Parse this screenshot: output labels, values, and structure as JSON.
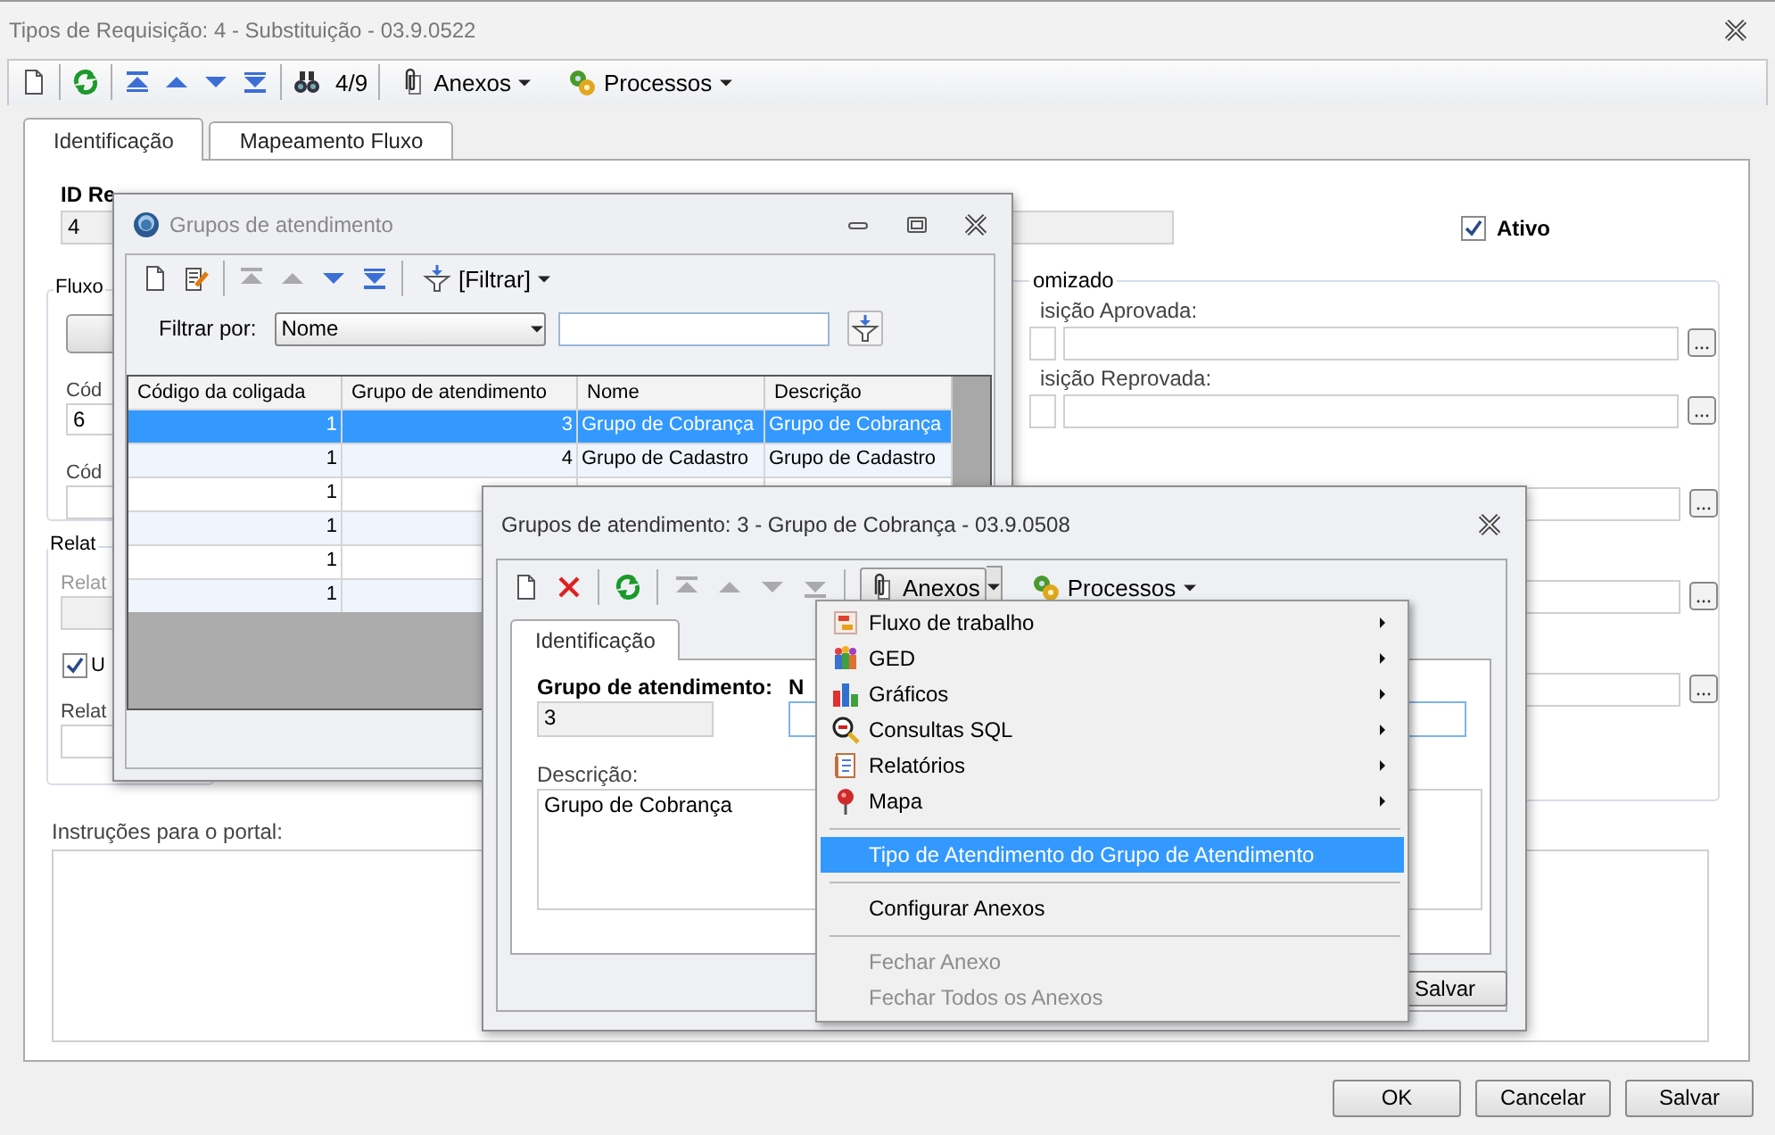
{
  "window": {
    "title": "Tipos de Requisição: 4 - Substituição - 03.9.0522"
  },
  "toolbar": {
    "record_counter": "4/9",
    "anexos": "Anexos",
    "processos": "Processos"
  },
  "tabs": [
    {
      "label": "Identificação",
      "selected": true
    },
    {
      "label": "Mapeamento Fluxo",
      "selected": false
    }
  ],
  "form": {
    "id_label": "ID Re",
    "id_value": "4",
    "ativo": {
      "label": "Ativo",
      "checked": true
    },
    "fluxo_group": {
      "title": "Fluxo",
      "label_1": "Cód",
      "value_1": "6",
      "label_2": "Cód"
    },
    "relat_group": {
      "title": "Relat",
      "label_1": "Relat",
      "check": {
        "label": "U",
        "checked": true
      },
      "label_2": "Relat"
    },
    "custom_group": {
      "title": "omizado",
      "label_approved": "isição Aprovada:",
      "label_rejected": "isição Reprovada:"
    },
    "instructions_label": "Instruções para o portal:"
  },
  "buttons": [
    {
      "label": "OK"
    },
    {
      "label": "Cancelar"
    },
    {
      "label": "Salvar"
    }
  ],
  "grupos_window": {
    "title": "Grupos de atendimento",
    "filter_button": "[Filtrar]",
    "filter_by_label": "Filtrar por:",
    "filter_by_value": "Nome",
    "columns": [
      "Código da coligada",
      "Grupo de atendimento",
      "Nome",
      "Descrição"
    ],
    "rows": [
      {
        "coligada": "1",
        "grupo": "3",
        "nome": "Grupo de Cobrança",
        "descricao": "Grupo de Cobrança",
        "selected": true
      },
      {
        "coligada": "1",
        "grupo": "4",
        "nome": "Grupo de Cadastro",
        "descricao": "Grupo de Cadastro",
        "selected": false
      },
      {
        "coligada": "1",
        "selected": false
      },
      {
        "coligada": "1",
        "selected": false
      },
      {
        "coligada": "1",
        "selected": false
      },
      {
        "coligada": "1",
        "selected": false
      }
    ]
  },
  "detail_window": {
    "title": "Grupos de atendimento: 3 - Grupo de Cobrança - 03.9.0508",
    "anexos": "Anexos",
    "processos": "Processos",
    "tab": "Identificação",
    "grupo_label": "Grupo de atendimento:",
    "grupo_value": "3",
    "nome_label": "N",
    "descricao_label": "Descrição:",
    "descricao_value": "Grupo de Cobrança",
    "save_button": "Salvar"
  },
  "anexos_menu": {
    "groups": [
      [
        {
          "label": "Fluxo de trabalho",
          "submenu": true,
          "disabled": false,
          "selected": false
        },
        {
          "label": "GED",
          "submenu": true,
          "disabled": false,
          "selected": false
        },
        {
          "label": "Gráficos",
          "submenu": true,
          "disabled": false,
          "selected": false
        },
        {
          "label": "Consultas SQL",
          "submenu": true,
          "disabled": false,
          "selected": false
        },
        {
          "label": "Relatórios",
          "submenu": true,
          "disabled": false,
          "selected": false
        },
        {
          "label": "Mapa",
          "submenu": true,
          "disabled": false,
          "selected": false
        }
      ],
      [
        {
          "label": "Tipo de Atendimento do Grupo de Atendimento",
          "submenu": false,
          "disabled": false,
          "selected": true
        }
      ],
      [
        {
          "label": "Configurar Anexos",
          "submenu": false,
          "disabled": false,
          "selected": false
        }
      ],
      [
        {
          "label": "Fechar Anexo",
          "submenu": false,
          "disabled": true,
          "selected": false
        },
        {
          "label": "Fechar Todos os Anexos",
          "submenu": false,
          "disabled": true,
          "selected": false
        }
      ]
    ]
  }
}
